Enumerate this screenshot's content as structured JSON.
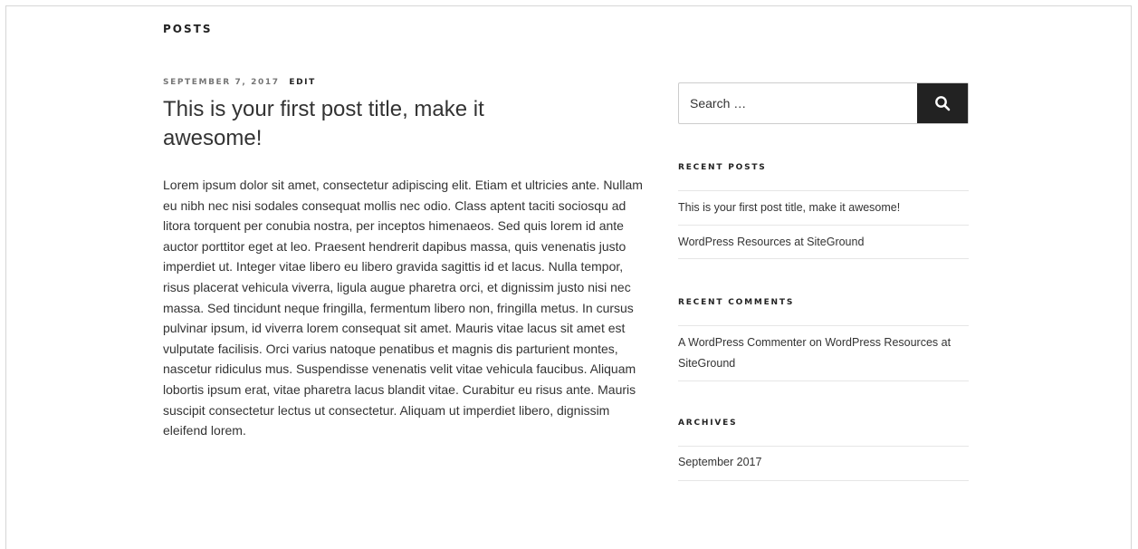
{
  "page": {
    "heading": "POSTS"
  },
  "post": {
    "date": "SEPTEMBER 7, 2017",
    "edit_label": "EDIT",
    "title": "This is your first post title, make it awesome!",
    "body": "Lorem ipsum dolor sit amet, consectetur adipiscing elit. Etiam et ultricies ante. Nullam eu nibh nec nisi sodales consequat mollis nec odio. Class aptent taciti sociosqu ad litora torquent per conubia nostra, per inceptos himenaeos. Sed quis lorem id ante auctor porttitor eget at leo. Praesent hendrerit dapibus massa, quis venenatis justo imperdiet ut. Integer vitae libero eu libero gravida sagittis id et lacus. Nulla tempor, risus placerat vehicula viverra, ligula augue pharetra orci, et dignissim justo nisi nec massa. Sed tincidunt neque fringilla, fermentum libero non, fringilla metus. In cursus pulvinar ipsum, id viverra lorem consequat sit amet. Mauris vitae lacus sit amet est vulputate facilisis. Orci varius natoque penatibus et magnis dis parturient montes, nascetur ridiculus mus. Suspendisse venenatis velit vitae vehicula faucibus. Aliquam lobortis ipsum erat, vitae pharetra lacus blandit vitae. Curabitur eu risus ante. Mauris suscipit consectetur lectus ut consectetur. Aliquam ut imperdiet libero, dignissim eleifend lorem."
  },
  "sidebar": {
    "search": {
      "placeholder": "Search …",
      "value": "",
      "button_icon": "search-icon"
    },
    "recent_posts": {
      "title": "RECENT POSTS",
      "items": [
        {
          "label": "This is your first post title, make it awesome!"
        },
        {
          "label": "WordPress Resources at SiteGround"
        }
      ]
    },
    "recent_comments": {
      "title": "RECENT COMMENTS",
      "items": [
        {
          "author": "A WordPress Commenter",
          "connector": "on",
          "post": "WordPress Resources at SiteGround"
        }
      ]
    },
    "archives": {
      "title": "ARCHIVES",
      "items": [
        {
          "label": "September 2017"
        }
      ]
    }
  },
  "colors": {
    "text": "#333333",
    "meta": "#767676",
    "button": "#222222",
    "border": "#e6e6e6"
  }
}
